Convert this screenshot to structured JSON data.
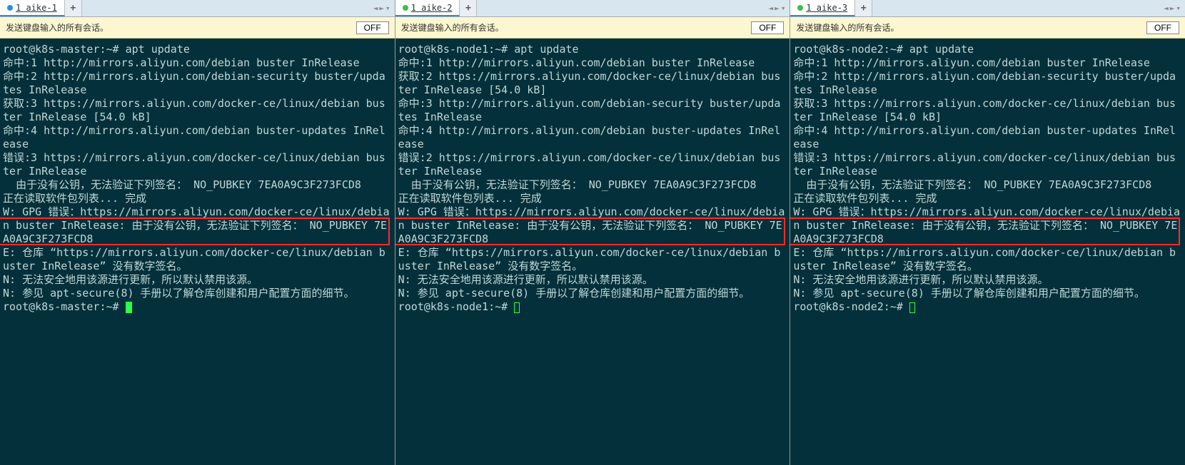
{
  "tabs": [
    {
      "dotColor": "blue",
      "label": "1 aike-1"
    },
    {
      "dotColor": "green",
      "label": "1 aike-2"
    },
    {
      "dotColor": "green",
      "label": "1 aike-3"
    }
  ],
  "newtab_label": "+",
  "nav_left": "◄",
  "nav_right": "►",
  "nav_menu": "▾",
  "yellowbar_text": "发送键盘输入的所有会话。",
  "off_label": "OFF",
  "highlight_text": "NO_PUBKEY 7EA0A9C3F273FCD8",
  "panes": [
    {
      "lines": [
        "root@k8s-master:~# apt update",
        "命中:1 http://mirrors.aliyun.com/debian buster InRelease",
        "命中:2 http://mirrors.aliyun.com/debian-security buster/updates InRelease",
        "获取:3 https://mirrors.aliyun.com/docker-ce/linux/debian buster InRelease [54.0 kB]",
        "命中:4 http://mirrors.aliyun.com/debian buster-updates InRelease",
        "错误:3 https://mirrors.aliyun.com/docker-ce/linux/debian buster InRelease",
        "  由于没有公钥，无法验证下列签名： NO_PUBKEY 7EA0A9C3F273FCD8",
        "正在读取软件包列表... 完成",
        "W: GPG 错误：https://mirrors.aliyun.com/docker-ce/linux/debian buster InRelease: 由于没有公钥，无法验证下列签名： NO_PUBKEY 7EA0A9C3F273FCD8",
        "E: 仓库 “https://mirrors.aliyun.com/docker-ce/linux/debian buster InRelease” 没有数字签名。",
        "N: 无法安全地用该源进行更新，所以默认禁用该源。",
        "N: 参见 apt-secure(8) 手册以了解仓库创建和用户配置方面的细节。",
        "root@k8s-master:~# "
      ],
      "cursor": "solid"
    },
    {
      "lines": [
        "root@k8s-node1:~# apt update",
        "命中:1 http://mirrors.aliyun.com/debian buster InRelease",
        "获取:2 https://mirrors.aliyun.com/docker-ce/linux/debian buster InRelease [54.0 kB]",
        "命中:3 http://mirrors.aliyun.com/debian-security buster/updates InRelease",
        "命中:4 http://mirrors.aliyun.com/debian buster-updates InRelease",
        "错误:2 https://mirrors.aliyun.com/docker-ce/linux/debian buster InRelease",
        "  由于没有公钥，无法验证下列签名： NO_PUBKEY 7EA0A9C3F273FCD8",
        "正在读取软件包列表... 完成",
        "W: GPG 错误：https://mirrors.aliyun.com/docker-ce/linux/debian buster InRelease: 由于没有公钥，无法验证下列签名： NO_PUBKEY 7EA0A9C3F273FCD8",
        "E: 仓库 “https://mirrors.aliyun.com/docker-ce/linux/debian buster InRelease” 没有数字签名。",
        "N: 无法安全地用该源进行更新，所以默认禁用该源。",
        "N: 参见 apt-secure(8) 手册以了解仓库创建和用户配置方面的细节。",
        "root@k8s-node1:~# "
      ],
      "cursor": "hollow"
    },
    {
      "lines": [
        "root@k8s-node2:~# apt update",
        "命中:1 http://mirrors.aliyun.com/debian buster InRelease",
        "命中:2 http://mirrors.aliyun.com/debian-security buster/updates InRelease",
        "获取:3 https://mirrors.aliyun.com/docker-ce/linux/debian buster InRelease [54.0 kB]",
        "命中:4 http://mirrors.aliyun.com/debian buster-updates InRelease",
        "错误:3 https://mirrors.aliyun.com/docker-ce/linux/debian buster InRelease",
        "  由于没有公钥，无法验证下列签名： NO_PUBKEY 7EA0A9C3F273FCD8",
        "正在读取软件包列表... 完成",
        "W: GPG 错误：https://mirrors.aliyun.com/docker-ce/linux/debian buster InRelease: 由于没有公钥，无法验证下列签名： NO_PUBKEY 7EA0A9C3F273FCD8",
        "E: 仓库 “https://mirrors.aliyun.com/docker-ce/linux/debian buster InRelease” 没有数字签名。",
        "N: 无法安全地用该源进行更新，所以默认禁用该源。",
        "N: 参见 apt-secure(8) 手册以了解仓库创建和用户配置方面的细节。",
        "root@k8s-node2:~# "
      ],
      "cursor": "hollow"
    }
  ]
}
